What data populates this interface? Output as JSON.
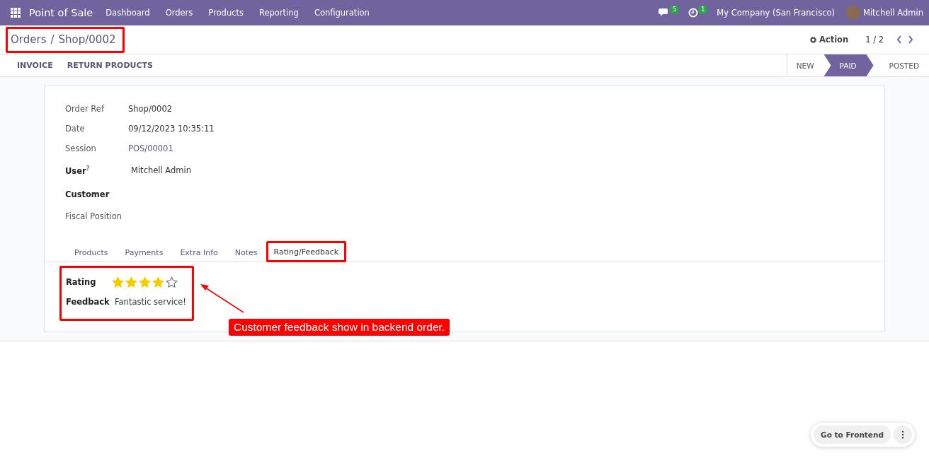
{
  "navbar": {
    "app": "Point of Sale",
    "menu": [
      "Dashboard",
      "Orders",
      "Products",
      "Reporting",
      "Configuration"
    ],
    "messages_count": "5",
    "activities_count": "1",
    "company": "My Company (San Francisco)",
    "user": "Mitchell Admin"
  },
  "breadcrumb": {
    "parent": "Orders",
    "separator": "/",
    "current": "Shop/0002"
  },
  "control": {
    "action": "Action",
    "pager": "1 / 2"
  },
  "buttons": [
    "INVOICE",
    "RETURN PRODUCTS"
  ],
  "statusbar": [
    {
      "label": "NEW",
      "selected": false
    },
    {
      "label": "PAID",
      "selected": true
    },
    {
      "label": "POSTED",
      "selected": false
    }
  ],
  "fields": [
    {
      "label": "Order Ref",
      "value": "Shop/0002",
      "kind": "text",
      "strong": false
    },
    {
      "label": "Date",
      "value": "09/12/2023 10:35:11",
      "kind": "text",
      "strong": false
    },
    {
      "label": "Session",
      "value": "POS/00001",
      "kind": "link",
      "strong": false
    },
    {
      "label": "User",
      "help": "?",
      "value": "Mitchell Admin",
      "kind": "text",
      "strong": true
    },
    {
      "label": "Customer",
      "strong": true
    },
    {
      "label": "Fiscal Position",
      "strong": false
    }
  ],
  "tabs": [
    {
      "label": "Products",
      "selected": false
    },
    {
      "label": "Payments",
      "selected": false
    },
    {
      "label": "Extra Info",
      "selected": false
    },
    {
      "label": "Notes",
      "selected": false
    },
    {
      "label": "Rating/Feedback",
      "selected": true
    }
  ],
  "rating": {
    "label": "Rating",
    "stars": 4
  },
  "feedback": {
    "label": "Feedback",
    "value": "Fantastic service!"
  },
  "annotation": {
    "text": "Customer feedback show in backend order."
  },
  "frontend_button": "Go to Frontend"
}
